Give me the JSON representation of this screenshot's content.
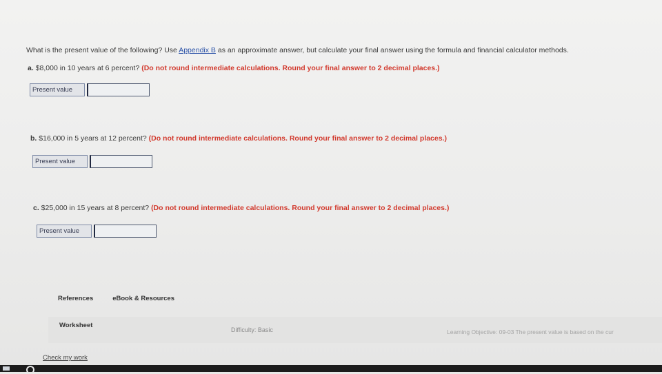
{
  "question": {
    "intro_before_link": "What is the present value of the following? Use ",
    "link": "Appendix B",
    "intro_after_link": " as an approximate answer, but calculate your final answer using the formula and financial calculator methods."
  },
  "parts": [
    {
      "letter": "a.",
      "text": " $8,000 in 10 years at 6 percent?",
      "note": "(Do not round intermediate calculations. Round your final answer to 2 decimal places.)",
      "answer_label": "Present value",
      "answer_value": ""
    },
    {
      "letter": "b.",
      "text": " $16,000 in 5 years at 12 percent?",
      "note": "(Do not round intermediate calculations. Round your final answer to 2 decimal places.)",
      "answer_label": "Present value",
      "answer_value": ""
    },
    {
      "letter": "c.",
      "text": " $25,000 in 15 years at 8 percent?",
      "note": "(Do not round intermediate calculations. Round your final answer to 2 decimal places.)",
      "answer_label": "Present value",
      "answer_value": ""
    }
  ],
  "tabs": {
    "references": "References",
    "ebook": "eBook & Resources"
  },
  "footer": {
    "worksheet": "Worksheet",
    "difficulty": "Difficulty: Basic",
    "objective": "Learning Objective: 09-03 The present value is based on the cur"
  },
  "check_work": "Check my work",
  "colors": {
    "link": "#2c53a8",
    "note": "#d23a2e"
  }
}
